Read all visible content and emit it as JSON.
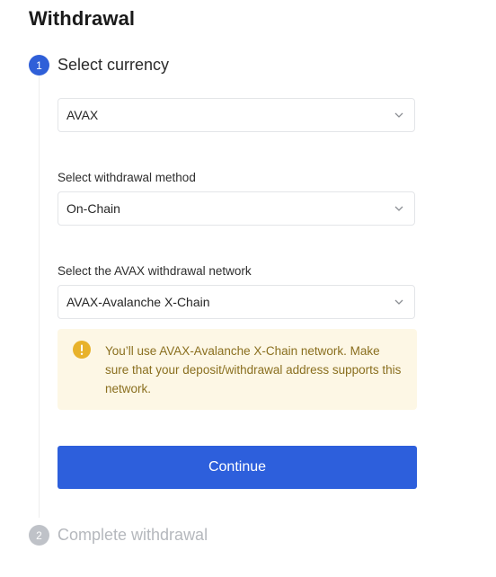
{
  "page": {
    "title": "Withdrawal"
  },
  "steps": [
    {
      "number": "1",
      "title": "Select currency",
      "state": "active"
    },
    {
      "number": "2",
      "title": "Complete withdrawal",
      "state": "inactive"
    }
  ],
  "currency": {
    "selected": "AVAX",
    "icon": "chevron-down-icon"
  },
  "method": {
    "label": "Select withdrawal method",
    "selected": "On-Chain",
    "icon": "chevron-down-icon"
  },
  "network": {
    "label": "Select the AVAX withdrawal network",
    "selected": "AVAX-Avalanche X-Chain",
    "icon": "chevron-down-icon"
  },
  "notice": {
    "icon": "warning-icon",
    "text": "You’ll use AVAX-Avalanche X-Chain network. Make sure that your deposit/withdrawal address supports this network."
  },
  "actions": {
    "continue_label": "Continue"
  },
  "colors": {
    "primary": "#2d5fdc",
    "step_inactive": "#bfc2c8",
    "notice_bg": "#fdf7e5",
    "notice_text": "#8a6f1f",
    "warning_icon": "#e8b22b"
  }
}
